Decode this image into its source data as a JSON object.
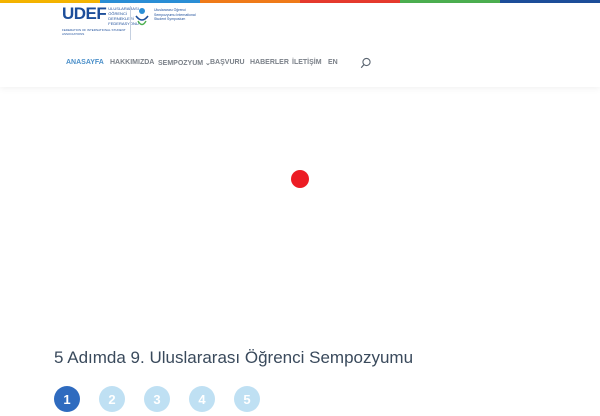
{
  "colors": {
    "topbar": [
      "#f5b400",
      "#2b8fd6",
      "#f07b1a",
      "#e63a2e",
      "#4caf50",
      "#1d4e9a"
    ],
    "accent": "#4a8fc9",
    "nav_text": "#7a8088",
    "loader_dot": "#ec1c24",
    "step_active": "#2f6bbf",
    "step_idle": "#bfe0f3"
  },
  "logo": {
    "udef": "UDEF",
    "udef_sub": "ULUSLARARASI ÖĞRENCİ DERNEKLERİ FEDERASYONU",
    "udef_foot": "FEDERATION OF INTERNATIONAL STUDENT ASSOCIATIONS",
    "symposium": "Uluslararası Öğrenci Sempozyumu International Student Symposium"
  },
  "nav": {
    "items": [
      {
        "label": "ANASAYFA",
        "active": true
      },
      {
        "label": "HAKKIMIZDA"
      },
      {
        "label": "SEMPOZYUM ⌄"
      },
      {
        "label": "BAŞVURU"
      },
      {
        "label": "HABERLER"
      },
      {
        "label": "İLETİŞİM"
      },
      {
        "label": "EN"
      }
    ],
    "search_icon": "search-icon"
  },
  "main": {
    "heading": "5 Adımda 9. Uluslararası Öğrenci Sempozyumu",
    "steps": [
      "1",
      "2",
      "3",
      "4",
      "5"
    ],
    "active_step": "1"
  }
}
